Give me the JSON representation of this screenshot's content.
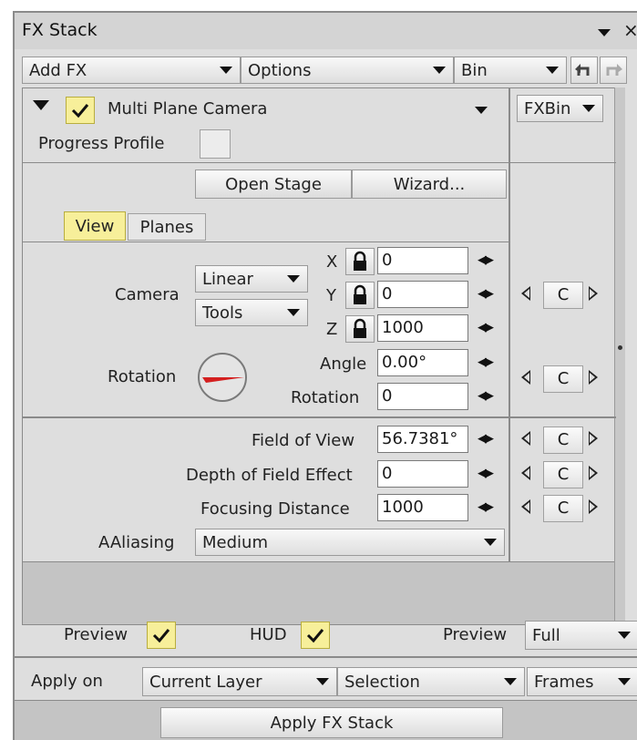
{
  "window": {
    "title": "FX Stack",
    "close_glyph": "×"
  },
  "toolbar": {
    "add_fx": "Add FX",
    "options": "Options",
    "bin": "Bin",
    "icons": [
      "undo-icon",
      "redo-icon"
    ]
  },
  "effect": {
    "name": "Multi Plane Camera",
    "enabled": true,
    "progress_profile_label": "Progress Profile",
    "fxbin_label": "FXBin"
  },
  "stage": {
    "open_stage": "Open Stage",
    "wizard": "Wizard..."
  },
  "tabs": [
    {
      "label": "View",
      "active": true
    },
    {
      "label": "Planes",
      "active": false
    }
  ],
  "camera": {
    "label": "Camera",
    "mode": "Linear",
    "tools": "Tools",
    "x": {
      "label": "X",
      "value": "0"
    },
    "y": {
      "label": "Y",
      "value": "0"
    },
    "z": {
      "label": "Z",
      "value": "1000"
    },
    "keyframe_button": "C"
  },
  "rotation": {
    "label": "Rotation",
    "angle_label": "Angle",
    "angle_value": "0.00°",
    "rotation_label": "Rotation",
    "rotation_value": "0",
    "keyframe_button": "C"
  },
  "lens": {
    "field_of_view": {
      "label": "Field of View",
      "value": "56.7381°"
    },
    "depth_of_field": {
      "label": "Depth of Field Effect",
      "value": "0"
    },
    "focusing_distance": {
      "label": "Focusing Distance",
      "value": "1000"
    },
    "keyframe_button": "C"
  },
  "antialiasing": {
    "label": "AAliasing",
    "value": "Medium"
  },
  "bottom": {
    "preview_label": "Preview",
    "preview_checked": true,
    "hud_label": "HUD",
    "hud_checked": true,
    "preview_mode_label": "Preview",
    "preview_mode_value": "Full",
    "apply_on_label": "Apply on",
    "apply_on_value": "Current Layer",
    "selection_value": "Selection",
    "frames_value": "Frames",
    "apply_button": "Apply FX Stack"
  },
  "colors": {
    "checkbox_fill": "#f7ef9a",
    "dial_needle": "#d42020",
    "panel_bg": "#dedede"
  }
}
